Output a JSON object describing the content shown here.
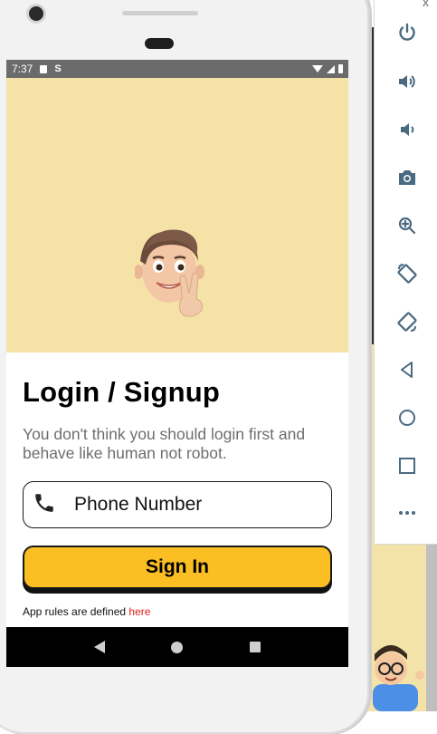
{
  "status_bar": {
    "time": "7:37"
  },
  "login": {
    "title": "Login / Signup",
    "subtitle": "You don't think you should login first and behave like human not robot.",
    "phone_placeholder": "Phone Number",
    "signin_label": "Sign In",
    "rules_text": "App rules are defined",
    "rules_link": "here"
  },
  "toolbar": {
    "close_label": "x",
    "icons": [
      "power-icon",
      "volume-up-icon",
      "volume-down-icon",
      "camera-icon",
      "zoom-icon",
      "rotate-left-icon",
      "rotate-right-icon",
      "back-icon",
      "home-icon",
      "overview-icon",
      "more-icon"
    ]
  },
  "colors": {
    "hero_bg": "#f5e2a6",
    "button_yellow": "#fbbf24",
    "link_red": "#e11d1d",
    "status_bar": "#6b6b6b",
    "toolbar_icon": "#4a6a82"
  }
}
